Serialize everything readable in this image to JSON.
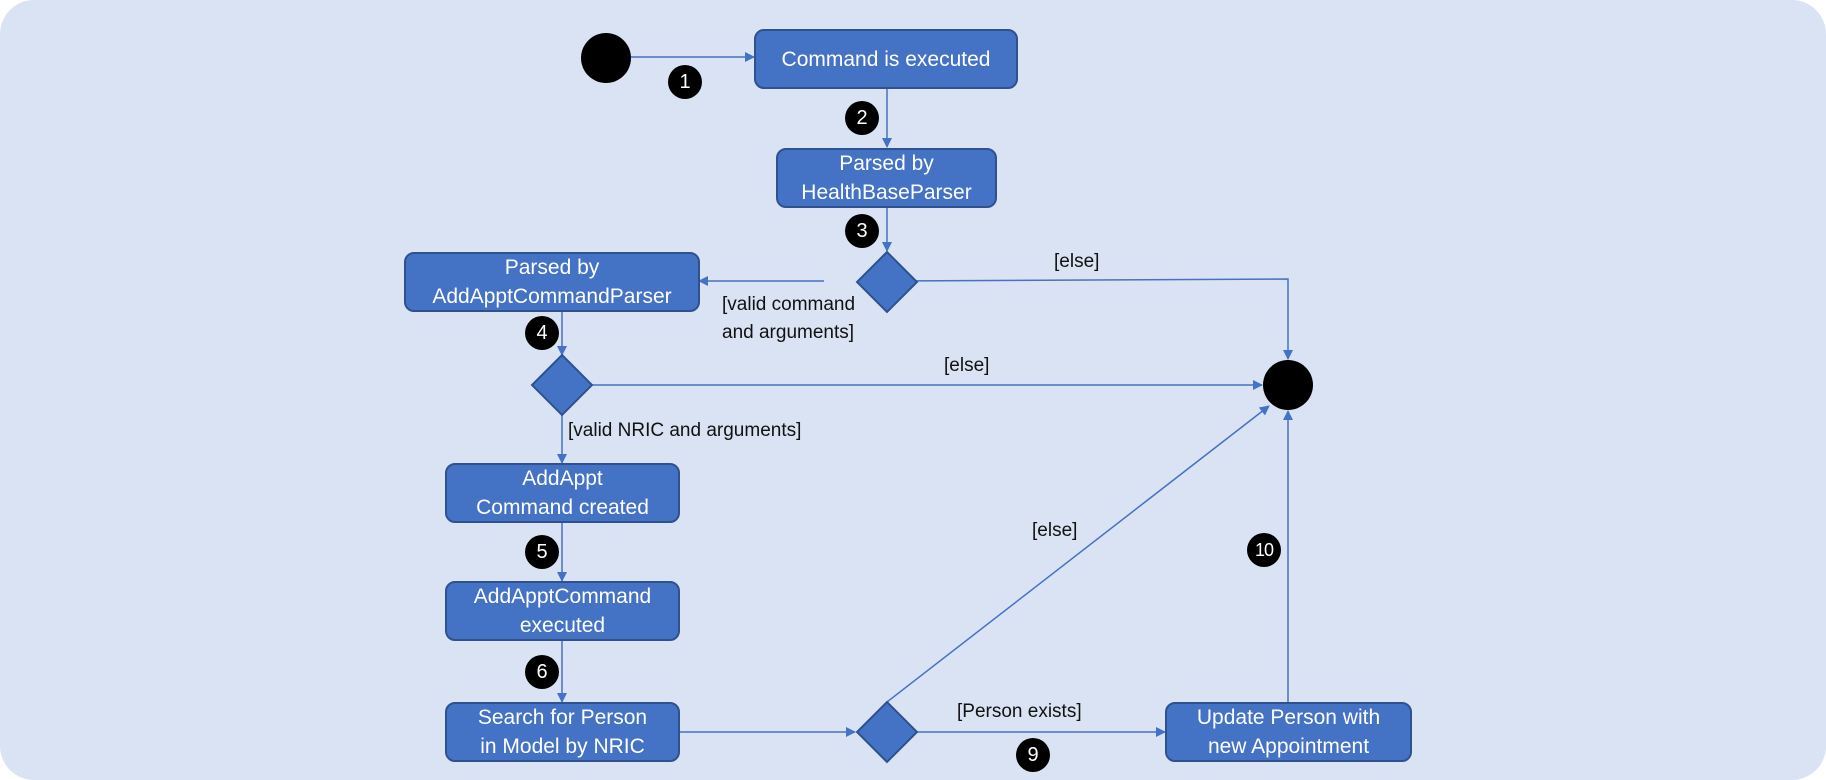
{
  "diagram": {
    "type": "activity-diagram",
    "colors": {
      "background": "#DAE3F3",
      "node_fill": "#4472C4",
      "node_border": "#2F528F",
      "edge": "#4472C4",
      "terminal": "#000000"
    },
    "nodes": {
      "command_executed": {
        "lines": [
          "Command is executed"
        ]
      },
      "parsed_healthbase": {
        "lines": [
          "Parsed by",
          "HealthBaseParser"
        ]
      },
      "parsed_addappt": {
        "lines": [
          "Parsed by",
          "AddApptCommandParser"
        ]
      },
      "addappt_created": {
        "lines": [
          "AddAppt",
          "Command created"
        ]
      },
      "addappt_executed": {
        "lines": [
          "AddApptCommand",
          "executed"
        ]
      },
      "search_person": {
        "lines": [
          "Search for Person",
          "in Model by NRIC"
        ]
      },
      "update_person": {
        "lines": [
          "Update Person with",
          "new Appointment"
        ]
      }
    },
    "guards": {
      "valid_command": [
        "[valid command",
        "and arguments]"
      ],
      "else_1": "[else]",
      "else_2": "[else]",
      "valid_nric": "[valid NRIC and arguments]",
      "else_3": "[else]",
      "person_exists": "[Person exists]"
    },
    "badges": [
      "1",
      "2",
      "3",
      "4",
      "5",
      "6",
      "9",
      "10"
    ]
  }
}
